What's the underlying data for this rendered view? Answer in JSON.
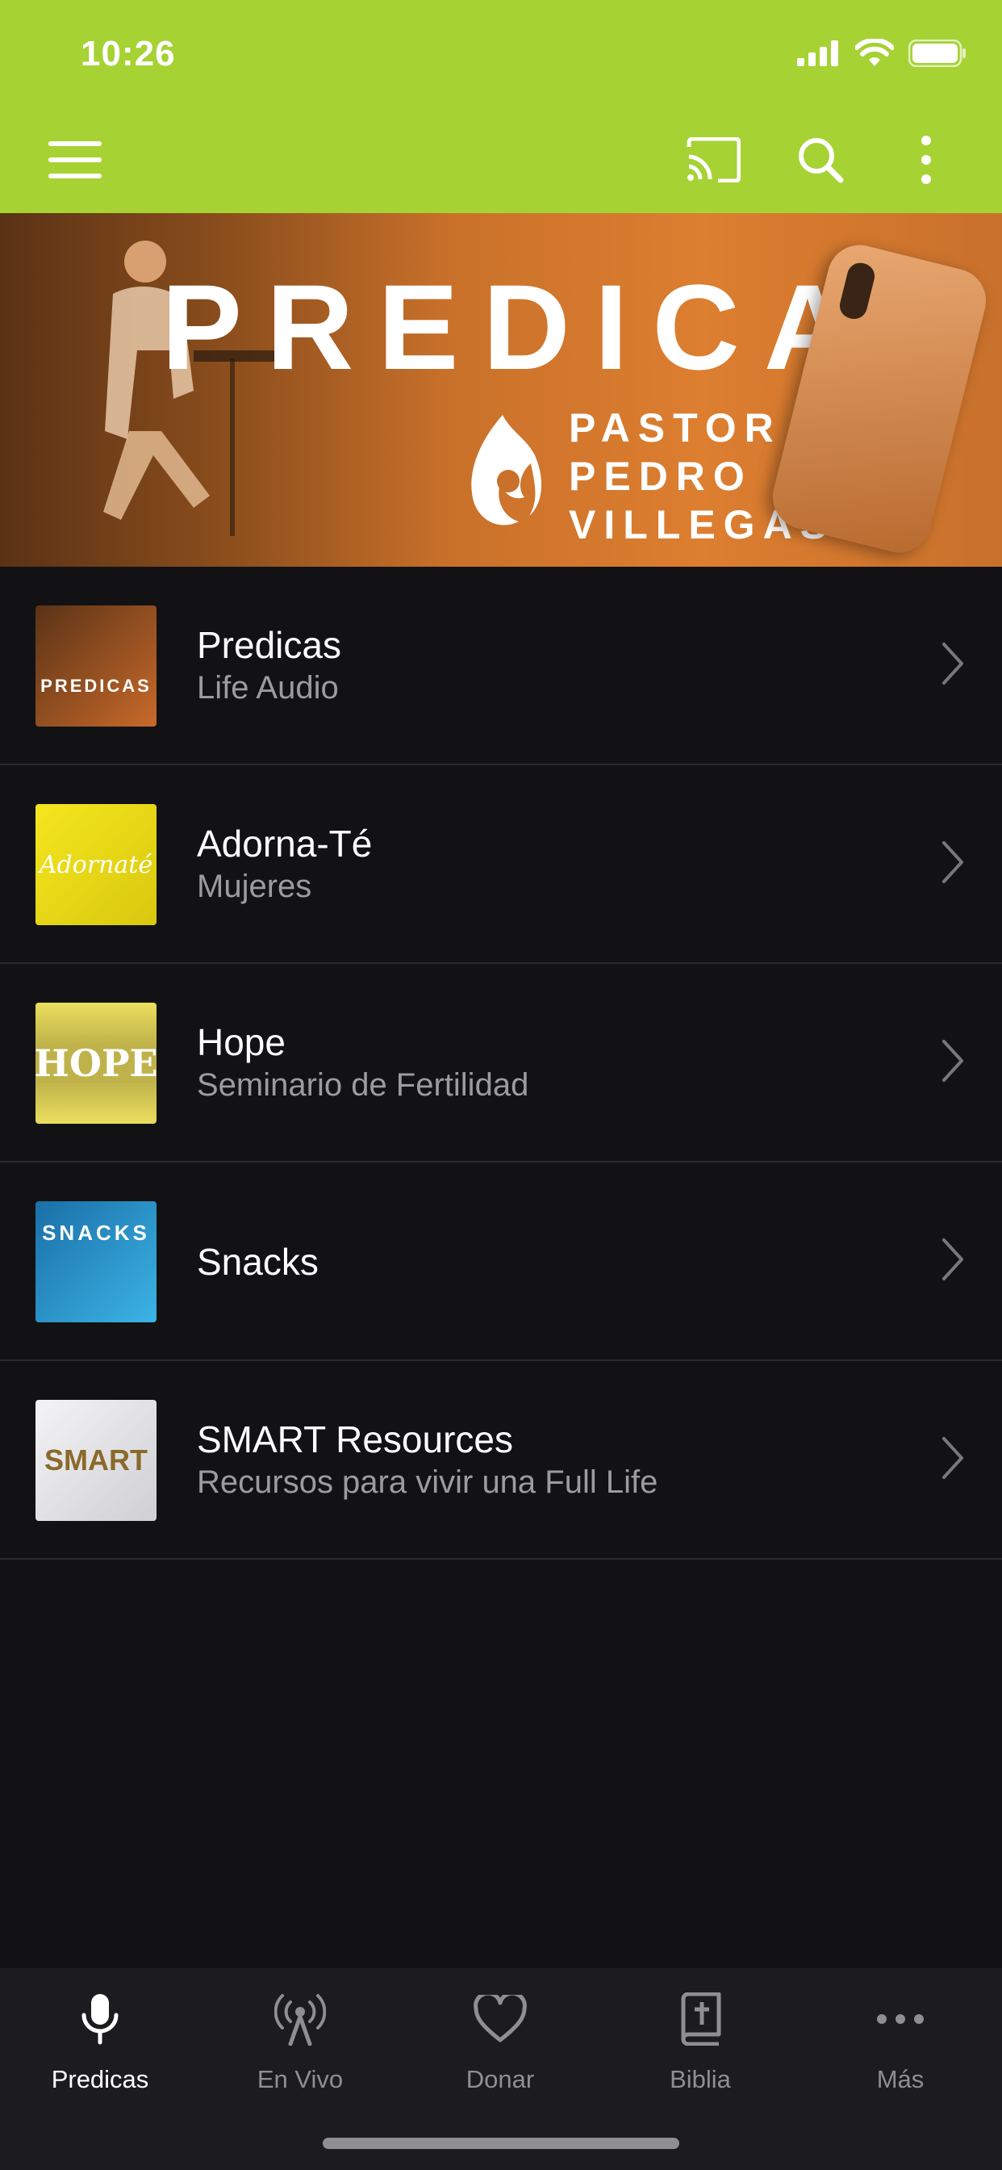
{
  "status": {
    "time": "10:26"
  },
  "toolbar": {
    "menu": "menu-icon",
    "cast": "cast-icon",
    "search": "search-icon",
    "more": "more-vertical-icon"
  },
  "banner": {
    "title": "PREDICAS",
    "subtitle_lines": [
      "PASTOR",
      "PEDRO",
      "VILLEGAS"
    ]
  },
  "list": [
    {
      "title": "Predicas",
      "subtitle": "Life Audio",
      "thumb_text": "PREDICAS",
      "thumb_color": "#c8692a"
    },
    {
      "title": "Adorna-Té",
      "subtitle": "Mujeres",
      "thumb_text": "Adornaté",
      "thumb_color": "#f1e11a"
    },
    {
      "title": "Hope",
      "subtitle": "Seminario de Fertilidad",
      "thumb_text": "HOPE",
      "thumb_color": "#e2d652"
    },
    {
      "title": "Snacks",
      "subtitle": "",
      "thumb_text": "SNACKS",
      "thumb_color": "#2aa2d8"
    },
    {
      "title": "SMART Resources",
      "subtitle": "Recursos para vivir una Full Life",
      "thumb_text": "SMART",
      "thumb_color": "#e8e8ea"
    }
  ],
  "tabs": [
    {
      "label": "Predicas",
      "icon": "microphone-icon",
      "active": true
    },
    {
      "label": "En Vivo",
      "icon": "broadcast-icon",
      "active": false
    },
    {
      "label": "Donar",
      "icon": "heart-icon",
      "active": false
    },
    {
      "label": "Biblia",
      "icon": "bible-icon",
      "active": false
    },
    {
      "label": "Más",
      "icon": "more-horizontal-icon",
      "active": false
    }
  ],
  "colors": {
    "accent": "#a6d234",
    "background": "#121215",
    "tabbar": "#1c1c1f"
  }
}
